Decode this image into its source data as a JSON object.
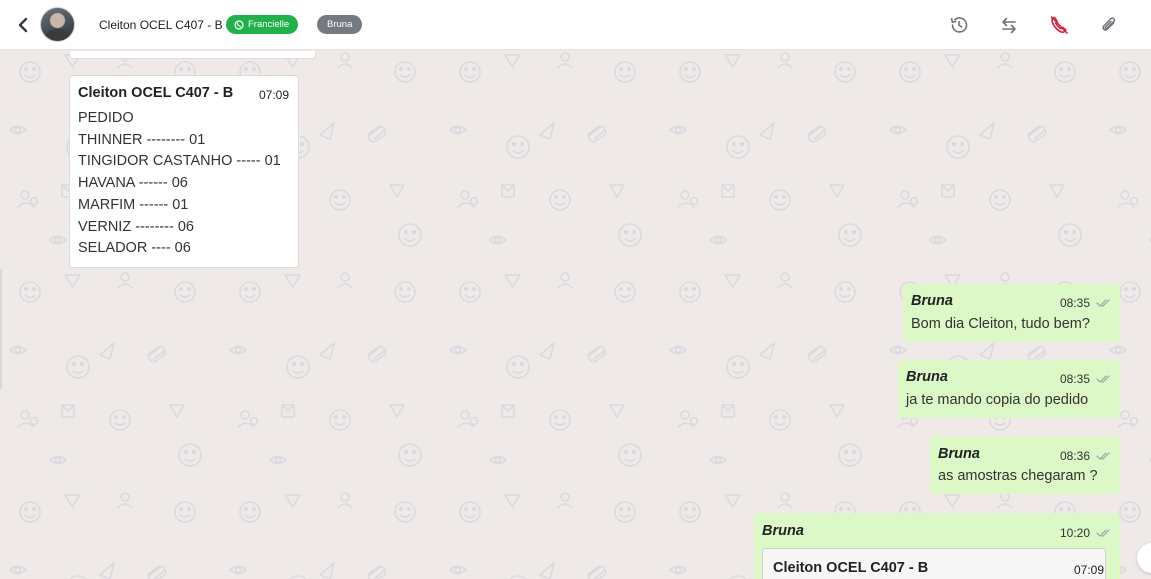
{
  "header": {
    "contact_name": "Cleiton OCEL C407 - B",
    "channel_tag": "Francielle",
    "user_tag": "Bruna"
  },
  "colors": {
    "outgoing_bubble": "#dcf8c6",
    "incoming_bubble": "#ffffff",
    "whatsapp_tag": "#21b14a",
    "call_icon": "#d6203a",
    "chat_background": "#efeae8"
  },
  "messages": {
    "incoming": {
      "sender": "Cleiton OCEL C407 - B",
      "time": "07:09",
      "lines": [
        "PEDIDO",
        "THINNER -------- 01",
        "TINGIDOR CASTANHO ----- 01",
        "HAVANA ------ 06",
        "MARFIM ------ 01",
        "VERNIZ -------- 06",
        "SELADOR ---- 06"
      ]
    },
    "outgoing": [
      {
        "sender": "Bruna",
        "time": "08:35",
        "text": "Bom dia Cleiton, tudo bem?"
      },
      {
        "sender": "Bruna",
        "time": "08:35",
        "text": "ja te mando copia do pedido"
      },
      {
        "sender": "Bruna",
        "time": "08:36",
        "text": "as amostras chegaram ?"
      },
      {
        "sender": "Bruna",
        "time": "10:20",
        "quoted_sender": "Cleiton OCEL C407 - B",
        "quoted_time": "07:09"
      }
    ]
  }
}
